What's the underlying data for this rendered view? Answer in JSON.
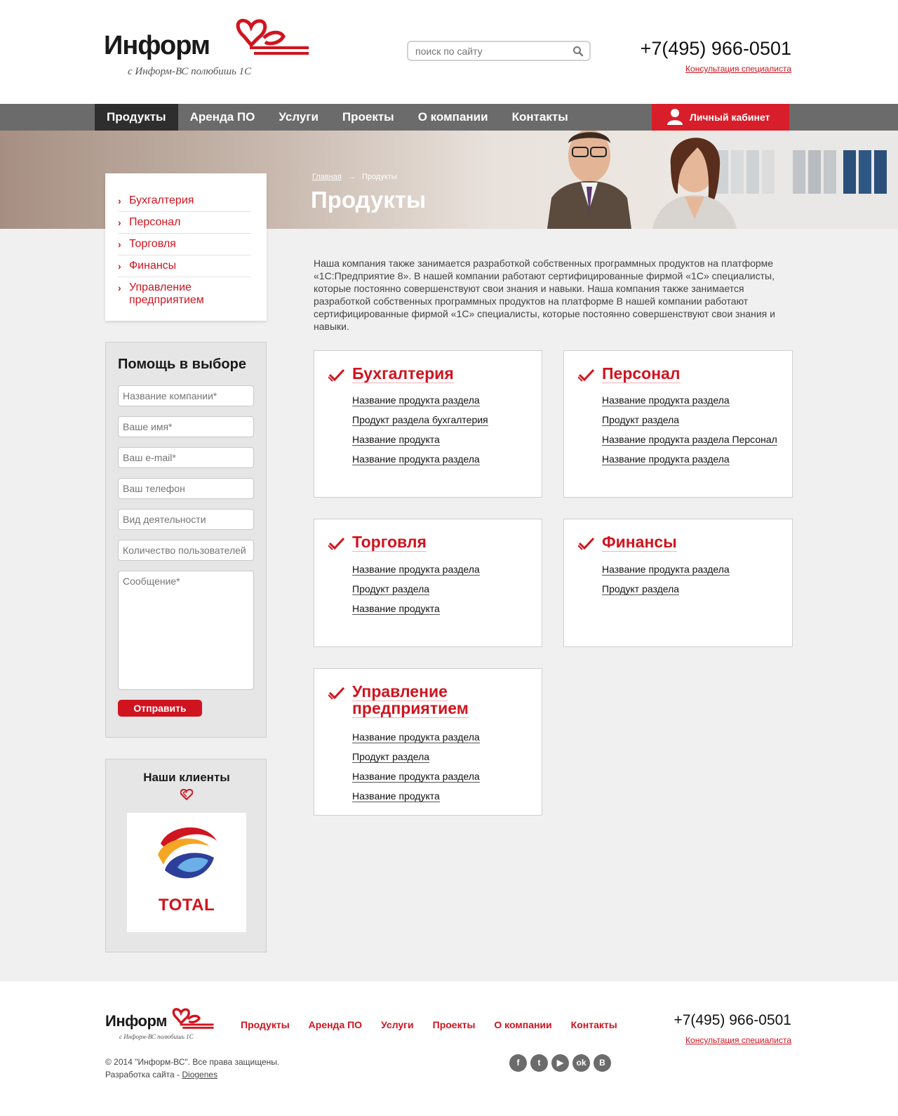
{
  "header": {
    "logo_text": "Информ",
    "logo_tagline": "с Информ-ВС полюбишь 1С",
    "search_placeholder": "поиск по сайту",
    "phone": "+7(495) 966-0501",
    "consult_link": "Консультация специалиста"
  },
  "nav": {
    "items": [
      "Продукты",
      "Аренда ПО",
      "Услуги",
      "Проекты",
      "О компании",
      "Контакты"
    ],
    "active": "Продукты",
    "cabinet_label": "Личный кабинет"
  },
  "hero": {
    "breadcrumb_home": "Главная",
    "breadcrumb_arrow": "→",
    "breadcrumb_current": "Продукты",
    "title": "Продукты"
  },
  "sidebar": {
    "menu": [
      "Бухгалтерия",
      "Персонал",
      "Торговля",
      "Финансы",
      "Управление предприятием"
    ],
    "help_title": "Помощь в выборе",
    "fields": {
      "company": "Название компании*",
      "name": "Ваше имя*",
      "email": "Ваш e-mail*",
      "phone": "Ваш телефон",
      "activity": "Вид деятельности",
      "users": "Количество пользователей",
      "message": "Сообщение*"
    },
    "submit_label": "Отправить",
    "clients_title": "Наши клиенты",
    "client_name": "TOTAL"
  },
  "main": {
    "intro": "Наша компания также занимается разработкой собственных программных продуктов на платформе «1С:Предприятие 8». В нашей компании работают сертифицированные фирмой «1С» специалисты, которые постоянно совершенствуют свои знания и навыки. Наша компания также занимается разработкой собственных программных продуктов на платформе В нашей компании работают сертифицированные фирмой «1С» специалисты, которые постоянно совершенствуют свои знания и навыки.",
    "cards": [
      {
        "title": "Бухгалтерия",
        "links": [
          "Название продукта раздела",
          "Продукт раздела бухгалтерия",
          "Название продукта",
          "Название продукта раздела"
        ]
      },
      {
        "title": "Персонал",
        "links": [
          "Название продукта раздела",
          "Продукт раздела",
          "Название продукта раздела Персонал",
          "Название продукта раздела"
        ]
      },
      {
        "title": "Торговля",
        "links": [
          "Название продукта раздела",
          "Продукт раздела",
          "Название продукта"
        ]
      },
      {
        "title": "Финансы",
        "links": [
          "Название продукта раздела",
          "Продукт раздела"
        ]
      },
      {
        "title": "Управление предприятием",
        "links": [
          "Название продукта раздела",
          "Продукт раздела",
          "Название продукта раздела",
          "Название продукта"
        ]
      }
    ]
  },
  "footer": {
    "logo_text": "Информ",
    "logo_tagline": "с Информ-ВС полюбишь 1С",
    "nav": [
      "Продукты",
      "Аренда ПО",
      "Услуги",
      "Проекты",
      "О компании",
      "Контакты"
    ],
    "phone": "+7(495) 966-0501",
    "consult_link": "Консультация специалиста",
    "copyright": "© 2014 \"Информ-ВС\". Все права защищены.",
    "dev_prefix": "Разработка сайта - ",
    "dev_link": "Diogenes",
    "socials": [
      {
        "name": "facebook-icon",
        "glyph": "f"
      },
      {
        "name": "twitter-icon",
        "glyph": "t"
      },
      {
        "name": "youtube-icon",
        "glyph": "▶"
      },
      {
        "name": "odnoklassniki-icon",
        "glyph": "ok"
      },
      {
        "name": "vkontakte-icon",
        "glyph": "B"
      }
    ]
  },
  "colors": {
    "accent": "#d0141f",
    "nav_bg": "#6b6b6b",
    "nav_active": "#2e2e2e"
  }
}
